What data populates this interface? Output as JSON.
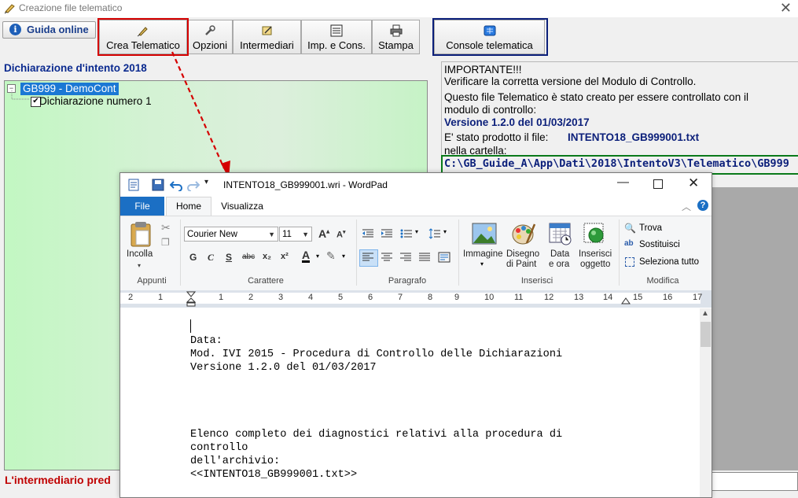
{
  "window": {
    "title": "Creazione file telematico",
    "close_glyph": "✕"
  },
  "toolbar": {
    "guida_label": "Guida online",
    "buttons": [
      "Crea Telematico",
      "Opzioni",
      "Intermediari",
      "Imp. e Cons.",
      "Stampa"
    ],
    "console_label": "Console telematica"
  },
  "left": {
    "section_title": "Dichiarazione d'intento 2018",
    "tree_root": "GB999 - DemoCont",
    "tree_child": "Dichiarazione numero 1",
    "bottom_message": "L'intermediario pred"
  },
  "info": {
    "line1": "IMPORTANTE!!!",
    "line2": "Verificare la corretta versione del Modulo di Controllo.",
    "line3": "Questo file Telematico è stato creato per essere controllato con il",
    "line4": "modulo di controllo:",
    "version": "Versione 1.2.0 del 01/03/2017",
    "produced_prefix": "E' stato prodotto il file:",
    "produced_file": "INTENTO18_GB999001.txt",
    "folder_label": "nella cartella:",
    "path": "C:\\GB_Guide_A\\App\\Dati\\2018\\IntentoV3\\Telematico\\GB999"
  },
  "wordpad": {
    "title": "INTENTO18_GB999001.wri - WordPad",
    "tabs": {
      "file": "File",
      "home": "Home",
      "view": "Visualizza"
    },
    "groups": {
      "clipboard": "Appunti",
      "font": "Carattere",
      "paragraph": "Paragrafo",
      "insert": "Inserisci",
      "edit": "Modifica"
    },
    "clipboard_paste": "Incolla",
    "font_name": "Courier New",
    "font_size": "11",
    "format_buttons": [
      "G",
      "C",
      "S",
      "abc",
      "x₂",
      "x²"
    ],
    "insert_buttons": {
      "image": "Immagine",
      "paint_1": "Disegno",
      "paint_2": "di Paint",
      "date_1": "Data",
      "date_2": "e ora",
      "object_1": "Inserisci",
      "object_2": "oggetto"
    },
    "edit_buttons": {
      "find": "Trova",
      "replace": "Sostituisci",
      "select_all": "Seleziona tutto"
    },
    "ruler_numbers": [
      "2",
      "1",
      "1",
      "2",
      "3",
      "4",
      "5",
      "6",
      "7",
      "8",
      "9",
      "10",
      "11",
      "12",
      "13",
      "14",
      "15",
      "16",
      "17"
    ],
    "document_lines": [
      "Data:",
      "Mod. IVI 2015 - Procedura di Controllo delle Dichiarazioni",
      "Versione 1.2.0 del 01/03/2017",
      "",
      "",
      "",
      "",
      "Elenco completo dei diagnostici relativi alla procedura di",
      "controllo",
      "dell'archivio:",
      "<<INTENTO18_GB999001.txt>>"
    ]
  },
  "colors": {
    "highlight_red": "#d50000",
    "highlight_blue": "#0b1f7a",
    "highlight_green": "#0a7a1a",
    "tree_bg": "#c6f3c6",
    "ribbon_file": "#1b6fc4"
  }
}
